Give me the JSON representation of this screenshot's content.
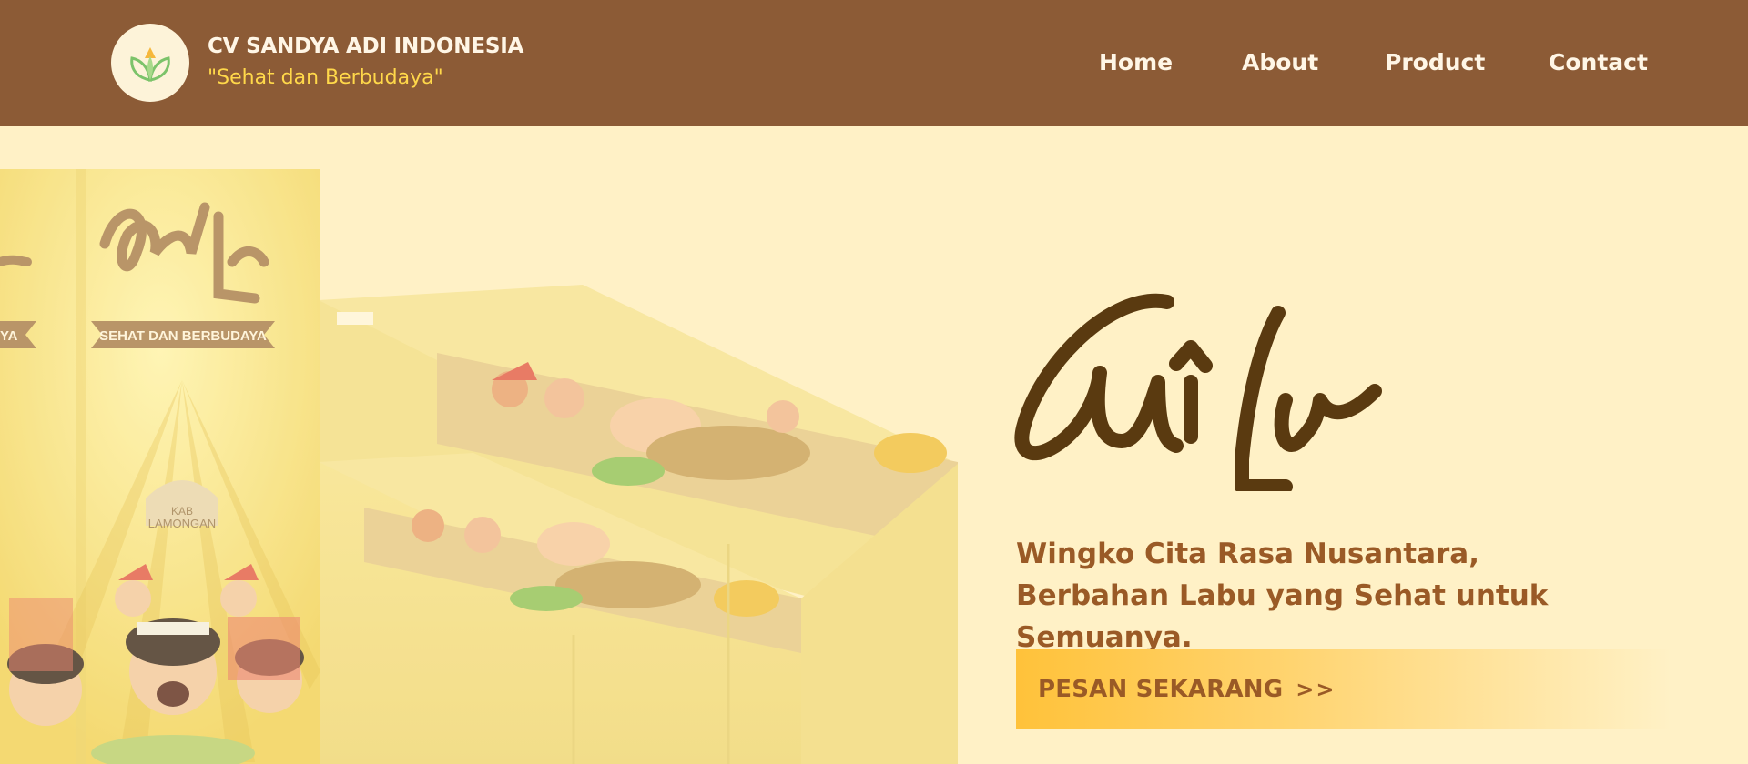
{
  "header": {
    "brand_name": "CV SANDYA ADI INDONESIA",
    "tagline": "\"Sehat dan Berbudaya\"",
    "logo_icon": "leaf-sprout-icon"
  },
  "nav": {
    "items": [
      {
        "label": "Home"
      },
      {
        "label": "About"
      },
      {
        "label": "Product"
      },
      {
        "label": "Contact"
      }
    ]
  },
  "hero": {
    "logo_text": "Cwila",
    "headline": "Wingko Cita Rasa Nusantara, Berbahan Labu yang Sehat untuk Semuanya.",
    "cta_label": "PESAN SEKARANG",
    "cta_arrow": ">>",
    "product_image": {
      "brand_label": "Cwila",
      "ribbon_text": "SEHAT DAN BERBUDAYA",
      "region_label": "KAB LAMONGAN"
    }
  },
  "colors": {
    "header_bg": "#8c5b36",
    "hero_bg": "#fff1c6",
    "accent_yellow": "#ffd84a",
    "headline_brown": "#9a5a26",
    "logo_dark": "#5a3a10",
    "cta_gradient_start": "#ffc23a"
  }
}
